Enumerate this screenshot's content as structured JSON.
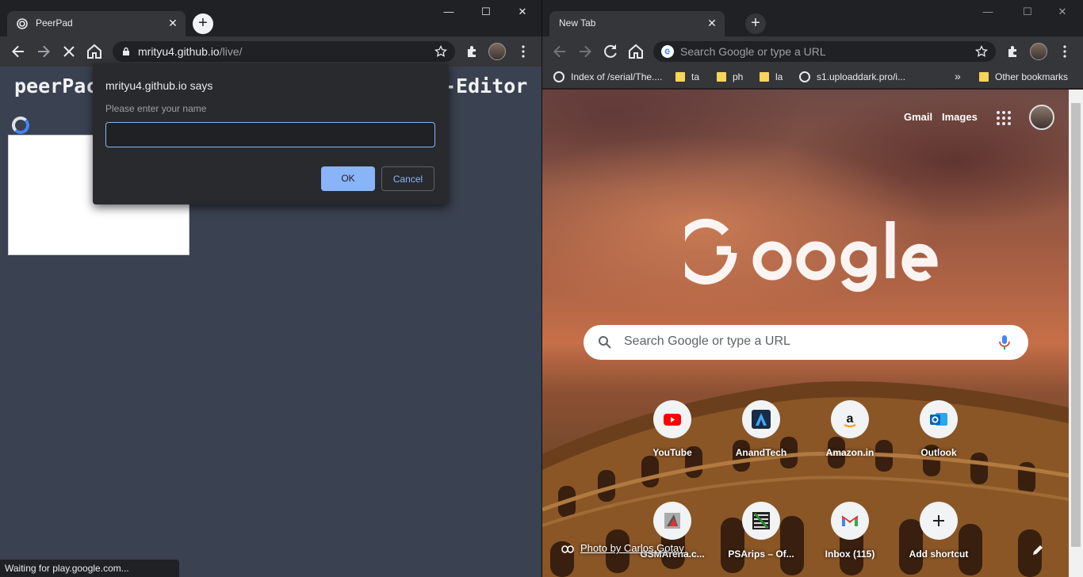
{
  "left_window": {
    "tab_title": "PeerPad",
    "tab_close": "✕",
    "new_tab": "+",
    "window_controls": {
      "minimize": "—",
      "maximize": "☐",
      "close": "✕"
    },
    "url_host": "mrityu4.github.io",
    "url_path": "/live/",
    "page_title_start": "peerPac",
    "page_title_end": "-Editor",
    "dialog": {
      "title": "mrityu4.github.io says",
      "message": "Please enter your name",
      "input_value": "",
      "ok_label": "OK",
      "cancel_label": "Cancel"
    },
    "status_text": "Waiting for play.google.com..."
  },
  "right_window": {
    "tab_title": "New Tab",
    "tab_close": "✕",
    "new_tab": "+",
    "window_controls": {
      "minimize": "—",
      "maximize": "☐",
      "close": "✕"
    },
    "omnibox_placeholder": "Search Google or type a URL",
    "bookmarks": [
      {
        "label": "Index of /serial/The....",
        "icon": "globe-icon"
      },
      {
        "label": "ta",
        "icon": "folder-icon"
      },
      {
        "label": "ph",
        "icon": "folder-icon"
      },
      {
        "label": "la",
        "icon": "folder-icon"
      },
      {
        "label": "s1.uploaddark.pro/i...",
        "icon": "globe-icon"
      }
    ],
    "bookmarks_overflow": "»",
    "other_bookmarks": "Other bookmarks",
    "ntp": {
      "gmail": "Gmail",
      "images": "Images",
      "search_placeholder": "Search Google or type a URL",
      "shortcuts": [
        {
          "label": "YouTube",
          "icon": "youtube-icon"
        },
        {
          "label": "AnandTech",
          "icon": "anandtech-icon"
        },
        {
          "label": "Amazon.in",
          "icon": "amazon-icon"
        },
        {
          "label": "Outlook",
          "icon": "outlook-icon"
        },
        {
          "label": "GSMArena.c...",
          "icon": "gsmarena-icon"
        },
        {
          "label": "PSArips – Of...",
          "icon": "psarips-icon"
        },
        {
          "label": "Inbox (115)",
          "icon": "gmail-icon"
        },
        {
          "label": "Add shortcut",
          "icon": "plus-icon"
        }
      ],
      "photo_credit": "Photo by Carlos Gotay"
    }
  }
}
